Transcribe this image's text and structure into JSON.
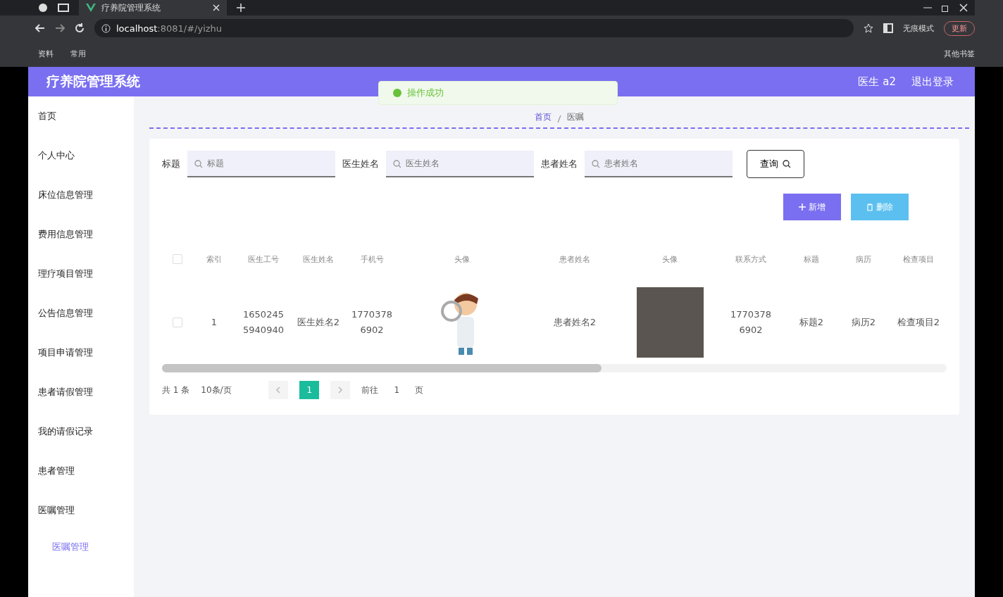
{
  "browser": {
    "tab_title": "疗养院管理系统",
    "url_host": "localhost",
    "url_path": ":8081/#/yizhu",
    "bookmarks": [
      "资料",
      "常用"
    ],
    "other_bookmarks": "其他书签",
    "incognito": "无痕模式",
    "update": "更新"
  },
  "header": {
    "title": "疗养院管理系统",
    "user": "医生 a2",
    "logout": "退出登录"
  },
  "toast": {
    "message": "操作成功"
  },
  "sidebar": {
    "items": [
      {
        "label": "首页"
      },
      {
        "label": "个人中心"
      },
      {
        "label": "床位信息管理"
      },
      {
        "label": "费用信息管理"
      },
      {
        "label": "理疗项目管理"
      },
      {
        "label": "公告信息管理"
      },
      {
        "label": "项目申请管理"
      },
      {
        "label": "患者请假管理"
      },
      {
        "label": "我的请假记录"
      },
      {
        "label": "患者管理"
      },
      {
        "label": "医嘱管理",
        "children": [
          {
            "label": "医嘱管理",
            "selected": true
          }
        ]
      }
    ]
  },
  "breadcrumb": [
    "首页",
    "医嘱"
  ],
  "search": {
    "fields": [
      {
        "label": "标题",
        "placeholder": "标题"
      },
      {
        "label": "医生姓名",
        "placeholder": "医生姓名"
      },
      {
        "label": "患者姓名",
        "placeholder": "患者姓名"
      }
    ],
    "query_button": "查询"
  },
  "actions": [
    {
      "kind": "add",
      "label": "新增"
    },
    {
      "kind": "delete",
      "label": "删除"
    }
  ],
  "table": {
    "columns": [
      "索引",
      "医生工号",
      "医生姓名",
      "手机号",
      "头像",
      "患者姓名",
      "头像",
      "联系方式",
      "标题",
      "病历",
      "检查项目"
    ],
    "header_checked": false,
    "rows": [
      {
        "checked": false,
        "cells": [
          "1",
          "16502455940940",
          "医生姓名2",
          "17703786902",
          {
            "kind": "cartoon"
          },
          "患者姓名2",
          {
            "kind": "photo"
          },
          "17703786902",
          "标题2",
          "病历2",
          "检查项目2"
        ]
      }
    ]
  },
  "pagination": {
    "total": "共 1 条",
    "page_size": "10条/页",
    "pages": [
      {
        "label": "1",
        "selected": true
      }
    ],
    "goto_label": "前往",
    "goto_value": "1",
    "goto_suffix": "页"
  }
}
